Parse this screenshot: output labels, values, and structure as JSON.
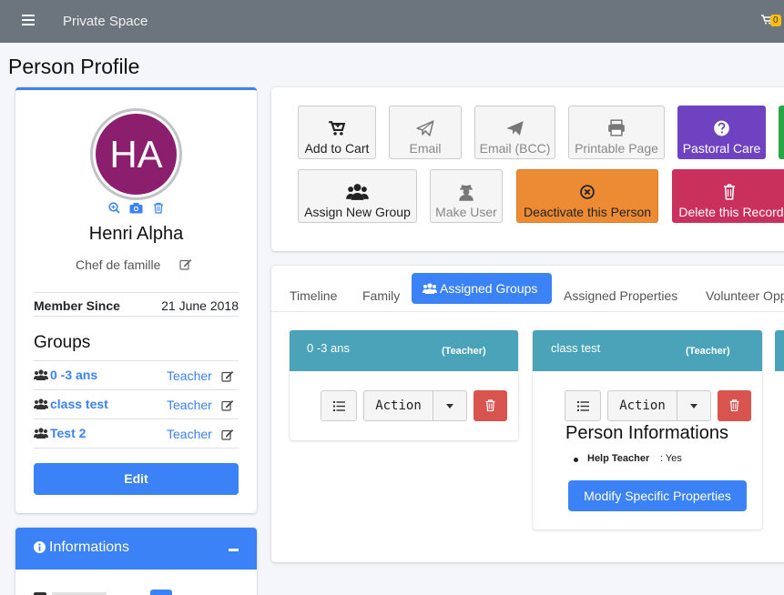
{
  "topbar": {
    "brand": "Private Space",
    "cart_count": "0"
  },
  "page_title": "Person Profile",
  "profile": {
    "initials": "HA",
    "avatar_color": "#8b1f6e",
    "name": "Henri Alpha",
    "role": "Chef de famille",
    "member_since_label": "Member Since",
    "member_since_value": "21 June 2018",
    "groups_title": "Groups",
    "groups": [
      {
        "name": "0 -3 ans",
        "role": "Teacher"
      },
      {
        "name": "class test",
        "role": "Teacher"
      },
      {
        "name": "Test 2",
        "role": "Teacher"
      }
    ],
    "edit_label": "Edit"
  },
  "informations": {
    "title": "Informations"
  },
  "actions": {
    "add_to_cart": "Add to Cart",
    "email": "Email",
    "email_bcc": "Email (BCC)",
    "printable_page": "Printable Page",
    "pastoral_care": "Pastoral Care",
    "assign_new_group": "Assign New Group",
    "make_user": "Make User",
    "deactivate": "Deactivate this Person",
    "delete_record": "Delete this Record"
  },
  "tabs": {
    "timeline": "Timeline",
    "family": "Family",
    "assigned_groups": "Assigned Groups",
    "assigned_properties": "Assigned Properties",
    "volunteer": "Volunteer Opp"
  },
  "group_cards": [
    {
      "title": "0 -3 ans",
      "role": "(Teacher)",
      "action_label": "Action"
    },
    {
      "title": "class test",
      "role": "(Teacher)",
      "action_label": "Action"
    }
  ],
  "person_informations": {
    "title": "Person Informations",
    "items": [
      {
        "label": "Help Teacher",
        "value": ": Yes"
      }
    ],
    "modify_label": "Modify Specific Properties"
  },
  "colors": {
    "primary": "#3b82f6",
    "topbar": "#6c757d",
    "group_header": "#4aa3b8",
    "pastoral": "#6f42c1",
    "deactivate": "#ec8b33",
    "delete": "#c9305c",
    "danger": "#d9534f"
  }
}
